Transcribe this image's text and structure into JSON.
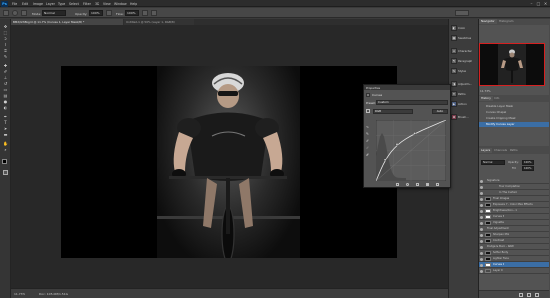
{
  "menubar": {
    "logo": "Ps",
    "items": [
      "File",
      "Edit",
      "Image",
      "Layer",
      "Type",
      "Select",
      "Filter",
      "3D",
      "View",
      "Window",
      "Help"
    ],
    "window_controls": [
      "–",
      "□",
      "✕"
    ]
  },
  "options": {
    "mode_label": "Mode:",
    "mode_value": "Normal",
    "opacity_label": "Opacity:",
    "opacity_value": "100%",
    "flow_label": "Flow:",
    "flow_value": "100%"
  },
  "doc_tabs": [
    {
      "label": "BMX/GT.Bkgrd @ 11.7% (Curves 1, Layer Mask/8) *",
      "active": true
    },
    {
      "label": "Untitled-1 @ 50% (Layer 1, RGB/8)",
      "active": false
    }
  ],
  "tools": [
    "move-tool",
    "marquee-tool",
    "lasso-tool",
    "quick-select-tool",
    "crop-tool",
    "eyedropper-tool",
    "healing-tool",
    "brush-tool",
    "clone-stamp-tool",
    "history-brush-tool",
    "eraser-tool",
    "gradient-tool",
    "blur-tool",
    "dodge-tool",
    "pen-tool",
    "type-tool",
    "path-select-tool",
    "shape-tool",
    "hand-tool",
    "zoom-tool"
  ],
  "statusbar": {
    "zoom": "11.73%",
    "doc_size": "Doc: 105.0M/1.51G"
  },
  "dock": [
    {
      "label": "Color",
      "icon": "color-icon"
    },
    {
      "label": "Swatches",
      "icon": "swatches-icon"
    },
    {
      "label": "Character",
      "icon": "character-icon"
    },
    {
      "label": "Paragraph",
      "icon": "paragraph-icon"
    },
    {
      "label": "Styles",
      "icon": "styles-icon"
    },
    {
      "label": "Adjustm...",
      "icon": "adjustments-icon"
    },
    {
      "label": "Paths",
      "icon": "paths-icon"
    },
    {
      "label": "Action",
      "icon": "actions-icon"
    },
    {
      "label": "Brush...",
      "icon": "brush-presets-icon"
    }
  ],
  "right_panels": {
    "nav_tabs": [
      "Navigator",
      "Histogram"
    ],
    "nav_zoom": "11.73%",
    "history_tabs": [
      "History",
      "Info"
    ],
    "history_items": [
      {
        "label": "Disable Layer Mask",
        "active": false
      },
      {
        "label": "Curves Chapel",
        "active": false
      },
      {
        "label": "Create Clipping Mask",
        "active": false
      },
      {
        "label": "Modify Curves Layer",
        "active": true
      }
    ],
    "layers_tabs": [
      "Layers",
      "Channels",
      "Paths"
    ],
    "blend_mode": "Normal",
    "opacity_label": "Opacity:",
    "opacity": "100%",
    "fill_label": "Fill:",
    "fill": "100%",
    "layers": [
      {
        "name": "Signature"
      },
      {
        "name": "Tour Completion"
      },
      {
        "name": "In The Curtain"
      },
      {
        "name": "Final Images"
      },
      {
        "name": "Exposure 7 - Color Max Effects"
      },
      {
        "name": "Brightness/Con...1"
      },
      {
        "name": "Curves 6"
      },
      {
        "name": "Vignette"
      },
      {
        "name": "Final Adjustment"
      },
      {
        "name": "Sharpen Mix"
      },
      {
        "name": "Contrast"
      },
      {
        "name": "Dodge & Burn - RAW"
      },
      {
        "name": "Softer Body"
      },
      {
        "name": "Lighter Face"
      },
      {
        "name": "Curves 1"
      },
      {
        "name": "Layer 0"
      }
    ]
  },
  "properties": {
    "tab": "Properties",
    "title": "Curves",
    "preset_label": "Preset:",
    "preset_value": "Custom",
    "channel_value": "RGB",
    "auto_label": "Auto",
    "curve_points": [
      [
        0,
        0
      ],
      [
        0.13,
        0.35
      ],
      [
        0.3,
        0.6
      ],
      [
        0.55,
        0.78
      ],
      [
        1,
        1
      ]
    ]
  },
  "colors": {
    "accent": "#31a8ff",
    "selection": "#3b6ea5",
    "nav_box": "#d62020"
  }
}
